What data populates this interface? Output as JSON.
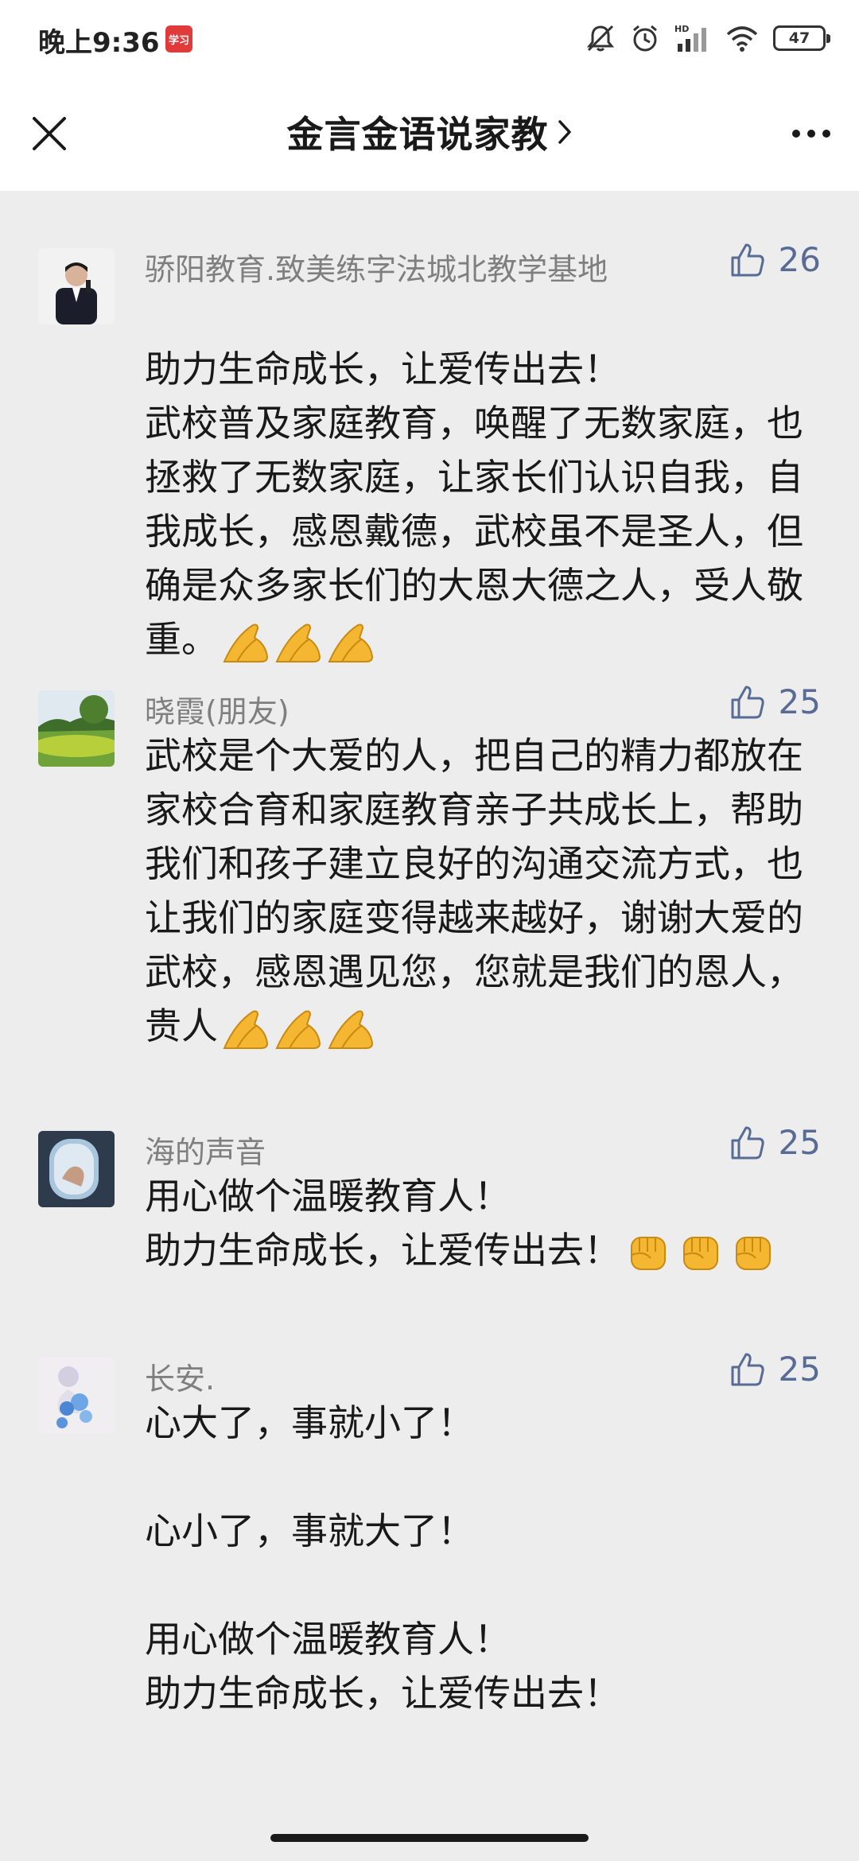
{
  "status_bar": {
    "time": "晚上9:36",
    "carrier_icon": "app-notification-icon",
    "battery": "47",
    "icons": [
      "mute-icon",
      "alarm-icon",
      "hd-signal-icon",
      "wifi-icon",
      "battery-icon"
    ]
  },
  "nav": {
    "title": "金言金语说家教",
    "close_icon": "close-icon",
    "chevron_icon": "chevron-right-icon",
    "more_icon": "more-icon"
  },
  "colors": {
    "background": "#ededed",
    "header": "#ffffff",
    "nickname": "#7f7f7f",
    "like_accent": "#576b95",
    "text": "#191919"
  },
  "comments": [
    {
      "nickname": "骄阳教育.致美练字法城北教学基地",
      "likes": "26",
      "text": "助力生命成长，让爱传出去！\n武校普及家庭教育，唤醒了无数家庭，也拯救了无数家庭，让家长们认识自我，自我成长，感恩戴德，武校虽不是圣人，但确是众多家长们的大恩大德之人，受人敬重。",
      "emoji": "folded-hands-emoji"
    },
    {
      "nickname": "晓霞(朋友)",
      "likes": "25",
      "text": "武校是个大爱的人，把自己的精力都放在家校合育和家庭教育亲子共成长上，帮助我们和孩子建立良好的沟通交流方式，也让我们的家庭变得越来越好，谢谢大爱的武校，感恩遇见您，您就是我们的恩人，贵人",
      "emoji": "folded-hands-emoji"
    },
    {
      "nickname": "海的声音",
      "likes": "25",
      "text": "用心做个温暖教育人！\n助力生命成长，让爱传出去！",
      "emoji": "raised-fist-emoji"
    },
    {
      "nickname": "长安.",
      "likes": "25",
      "text": "心大了，事就小了！\n\n心小了，事就大了！\n\n用心做个温暖教育人！\n助力生命成长，让爱传出去！",
      "emoji": ""
    }
  ]
}
